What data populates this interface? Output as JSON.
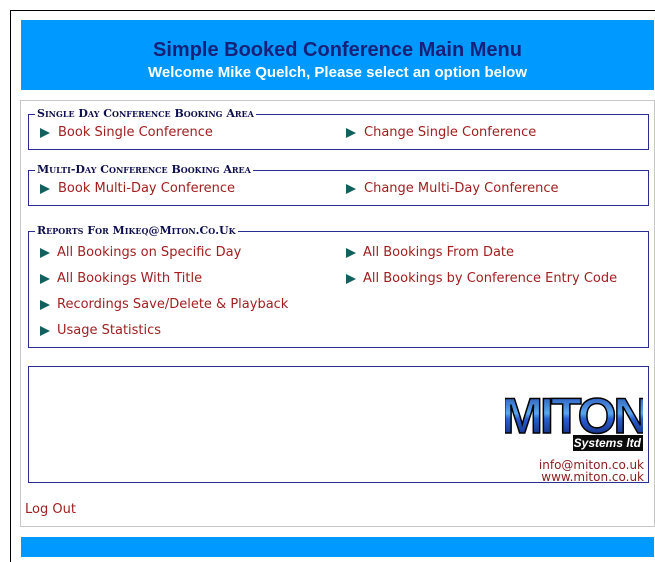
{
  "header": {
    "title": "Simple Booked Conference Main Menu",
    "welcome": "Welcome Mike Quelch, Please select an option below"
  },
  "single_day": {
    "legend": "Single Day Conference Booking Area",
    "book": "Book Single Conference",
    "change": "Change Single Conference"
  },
  "multi_day": {
    "legend": "Multi-Day Conference Booking Area",
    "book": "Book Multi-Day Conference",
    "change": "Change Multi-Day Conference"
  },
  "reports": {
    "legend": "Reports For Mikeq@Miton.Co.Uk",
    "specific_day": "All Bookings on Specific Day",
    "from_date": "All Bookings From Date",
    "with_title": "All Bookings With Title",
    "by_entry_code": "All Bookings by Conference Entry Code",
    "recordings": "Recordings Save/Delete & Playback",
    "usage": "Usage Statistics"
  },
  "logo": {
    "brand": "MITON",
    "tagline": "Systems ltd",
    "email": "info@miton.co.uk",
    "website": "www.miton.co.uk"
  },
  "logout": "Log Out",
  "colors": {
    "header_bg": "#0099ff",
    "title": "#16227a",
    "link": "#a02020",
    "arrow": "#13615f",
    "border": "#2a2f8f"
  }
}
